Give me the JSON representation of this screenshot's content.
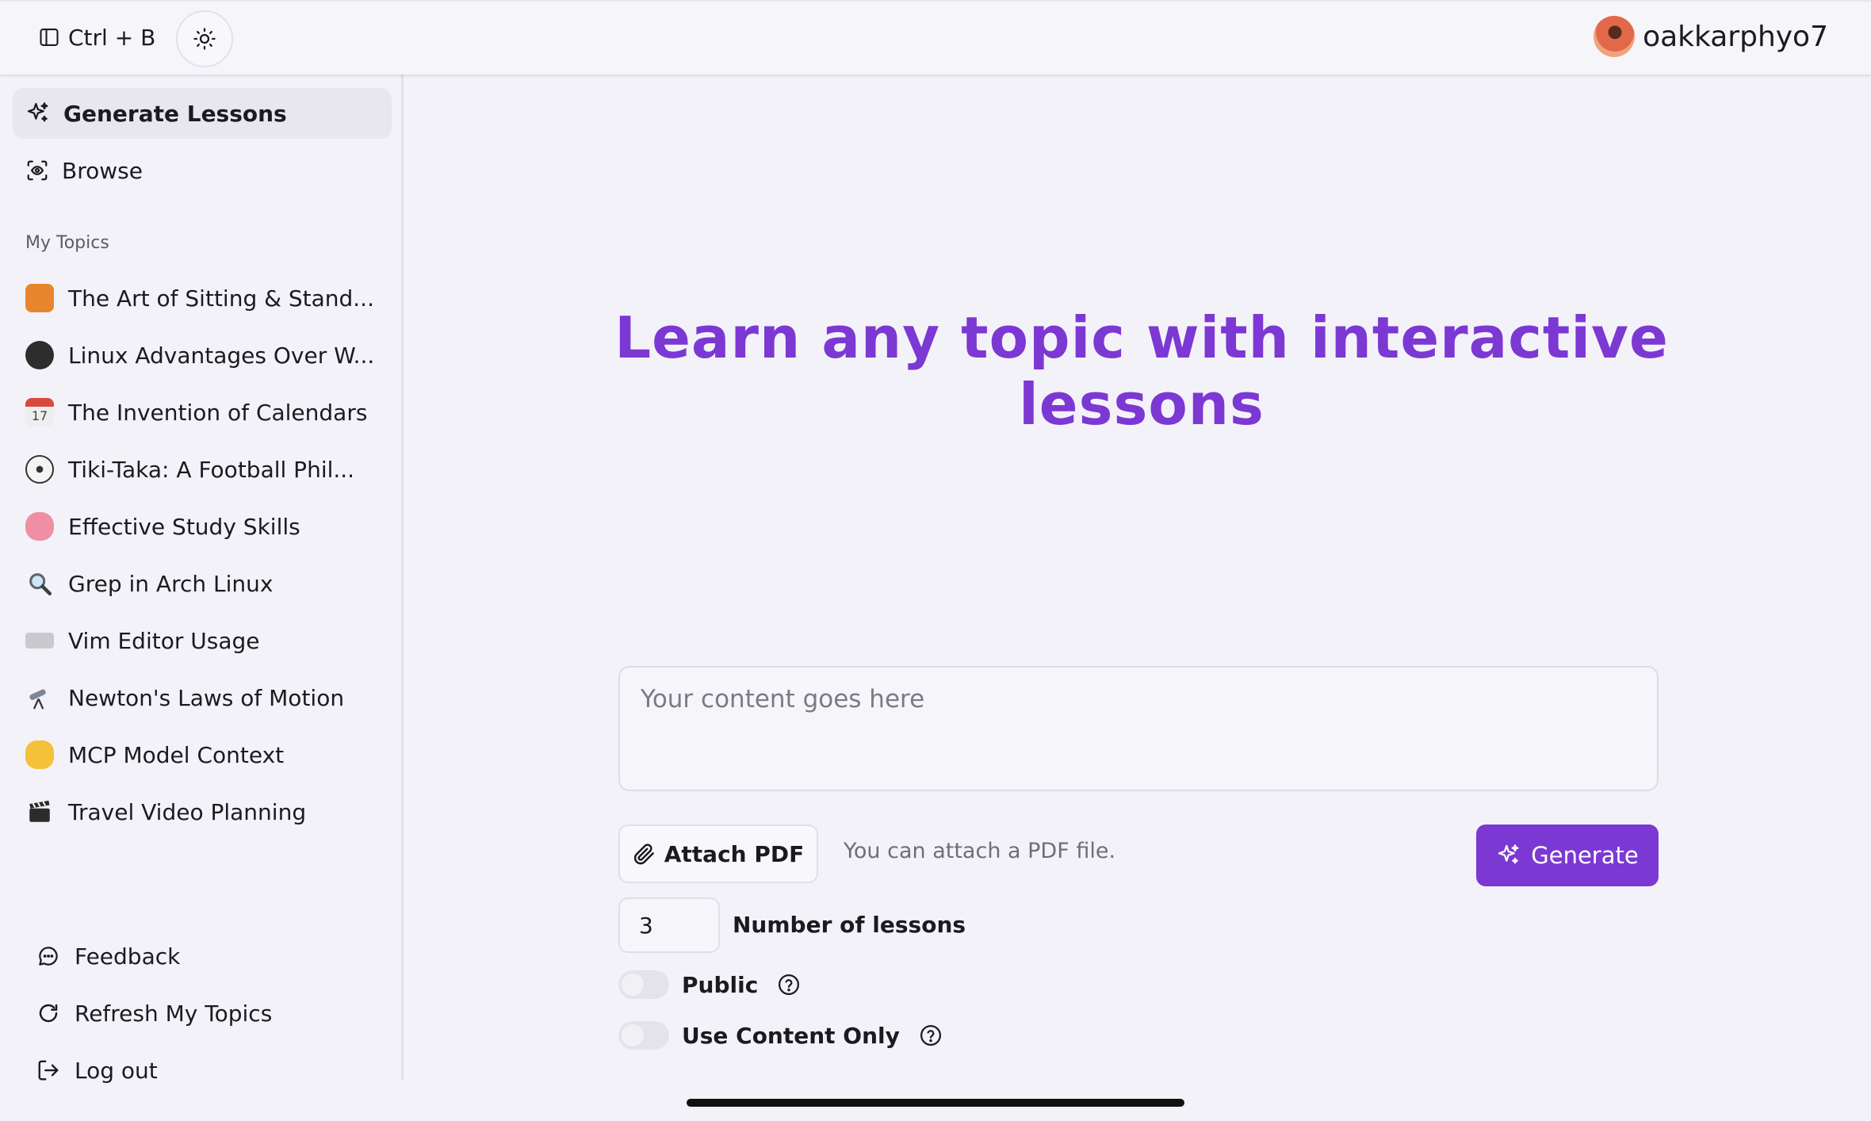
{
  "header": {
    "sidebar_shortcut": "Ctrl + B",
    "username": "oakkarphyo7"
  },
  "sidebar": {
    "nav": [
      {
        "label": "Generate Lessons",
        "icon": "sparkle-icon",
        "active": true
      },
      {
        "label": "Browse",
        "icon": "scan-icon",
        "active": false
      }
    ],
    "section_label": "My Topics",
    "topics": [
      {
        "label": "The Art of Sitting & Stand...",
        "emoji": "🦺"
      },
      {
        "label": "Linux Advantages Over W...",
        "emoji": "🐧"
      },
      {
        "label": "The Invention of Calendars",
        "emoji": "📅"
      },
      {
        "label": "Tiki-Taka: A Football Phil...",
        "emoji": "⚽"
      },
      {
        "label": "Effective Study Skills",
        "emoji": "🧠"
      },
      {
        "label": "Grep in Arch Linux",
        "emoji": "🔍"
      },
      {
        "label": "Vim Editor Usage",
        "emoji": "⌨️"
      },
      {
        "label": "Newton's Laws of Motion",
        "emoji": "🔭"
      },
      {
        "label": "MCP Model Context",
        "emoji": "🤝"
      },
      {
        "label": "Travel Video Planning",
        "emoji": "🎬"
      }
    ],
    "bottom": [
      {
        "label": "Feedback",
        "icon": "message-circle-icon"
      },
      {
        "label": "Refresh My Topics",
        "icon": "refresh-icon"
      },
      {
        "label": "Log out",
        "icon": "logout-icon"
      }
    ]
  },
  "main": {
    "title": "Learn any topic with interactive lessons",
    "content_placeholder": "Your content goes here",
    "attach_label": "Attach PDF",
    "attach_hint": "You can attach a PDF file.",
    "generate_label": "Generate",
    "lessons_value": "3",
    "lessons_label": "Number of lessons",
    "public_label": "Public",
    "public_on": false,
    "content_only_label": "Use Content Only",
    "content_only_on": false
  },
  "colors": {
    "accent": "#7c38d3",
    "background": "#f4f2f9"
  }
}
